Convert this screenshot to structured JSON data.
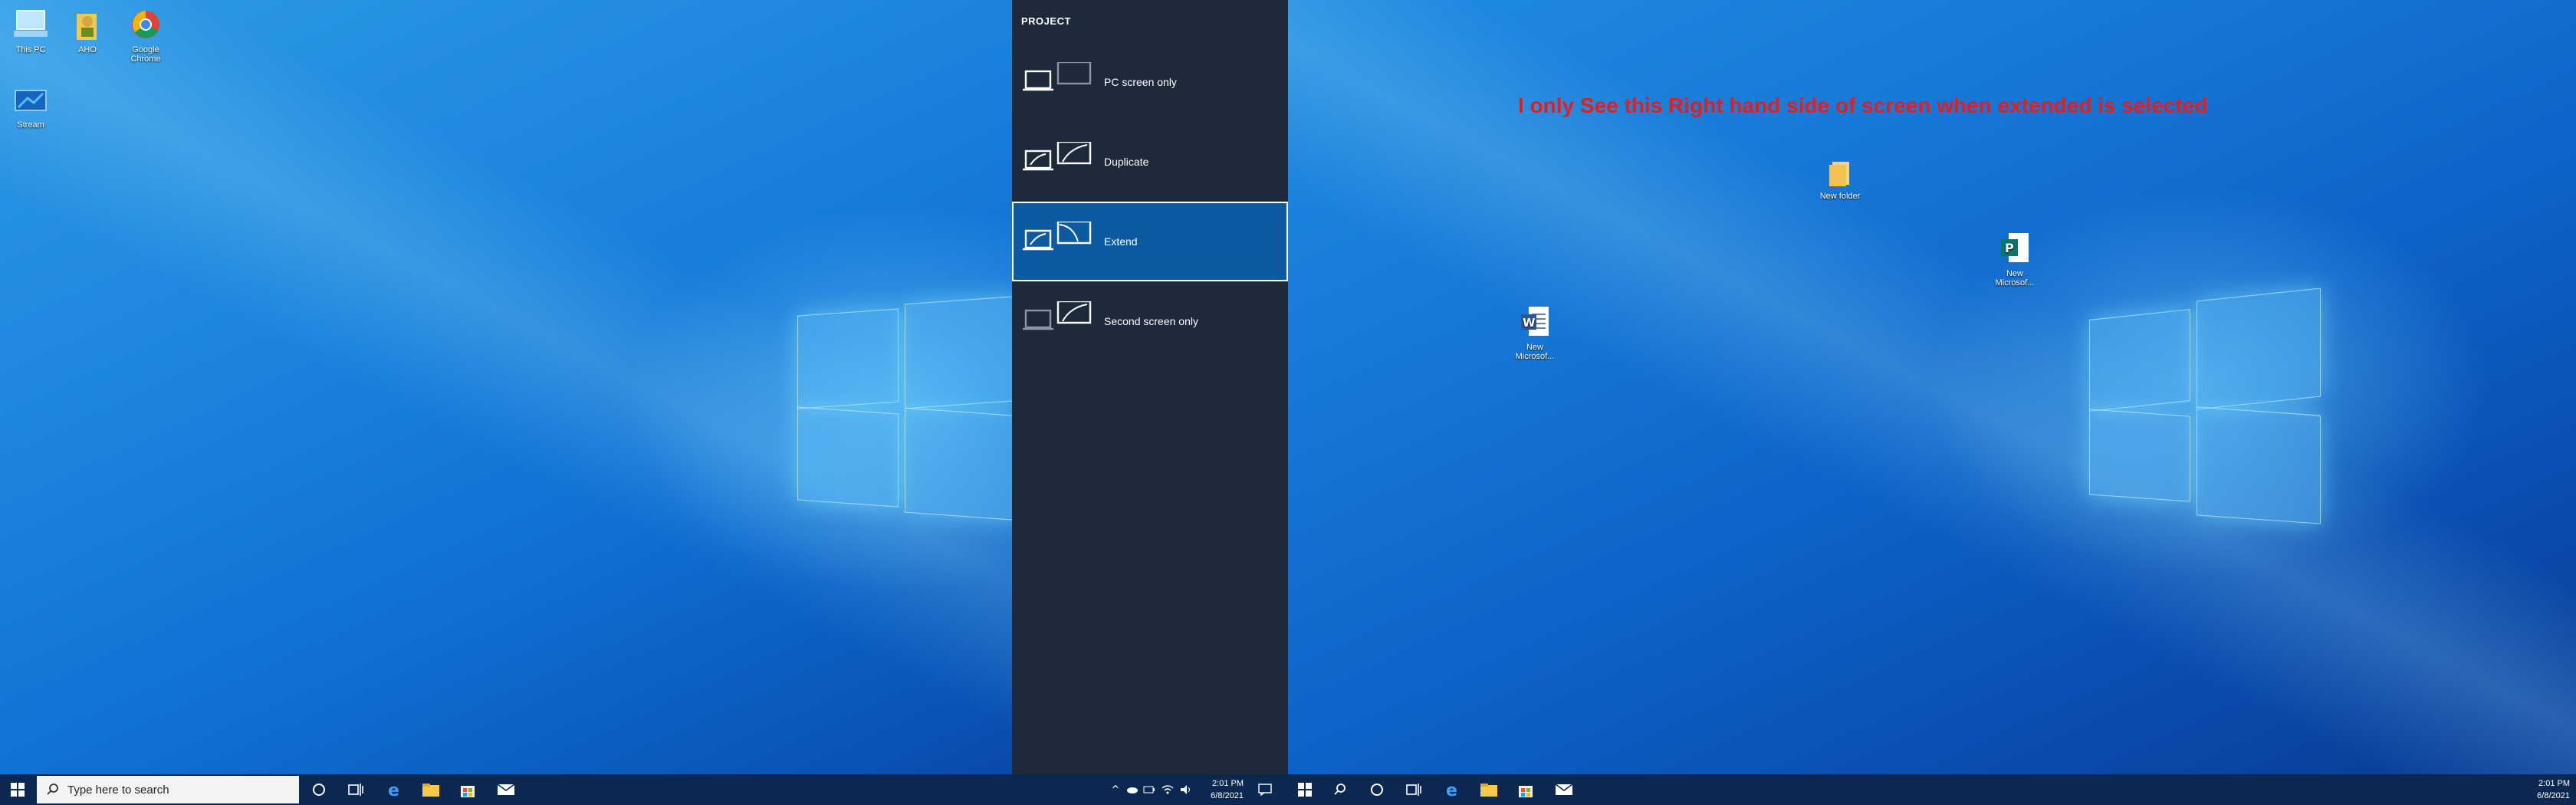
{
  "left_monitor": {
    "desktop_icons": [
      {
        "label": "This PC",
        "icon": "computer-icon"
      },
      {
        "label": "AHO",
        "icon": "user-folder-icon"
      },
      {
        "label": "Google Chrome",
        "icon": "chrome-icon"
      },
      {
        "label": "Stream",
        "icon": "stream-icon"
      }
    ],
    "taskbar": {
      "search_placeholder": "Type here to search",
      "clock_time": "2:01 PM",
      "clock_date": "6/8/2021"
    }
  },
  "project_panel": {
    "title": "PROJECT",
    "options": [
      {
        "label": "PC screen only",
        "icon": "pc-screen-only-icon",
        "selected": false
      },
      {
        "label": "Duplicate",
        "icon": "duplicate-icon",
        "selected": false
      },
      {
        "label": "Extend",
        "icon": "extend-icon",
        "selected": true
      },
      {
        "label": "Second screen only",
        "icon": "second-screen-only-icon",
        "selected": false
      }
    ]
  },
  "right_monitor": {
    "annotation": "I only See this Right hand side of screen when extended is selected",
    "desktop_icons": [
      {
        "label": "New folder",
        "icon": "folder-icon"
      },
      {
        "label": "New Microsof...",
        "icon": "publisher-icon"
      },
      {
        "label": "New Microsof...",
        "icon": "word-icon"
      }
    ],
    "taskbar": {
      "clock_time": "2:01 PM",
      "clock_date": "6/8/2021"
    }
  },
  "colors": {
    "annotation": "#e81c1c",
    "project_bg": "#1e2a3b",
    "project_selected": "#0e5aa0",
    "taskbar": "#0c2850"
  }
}
